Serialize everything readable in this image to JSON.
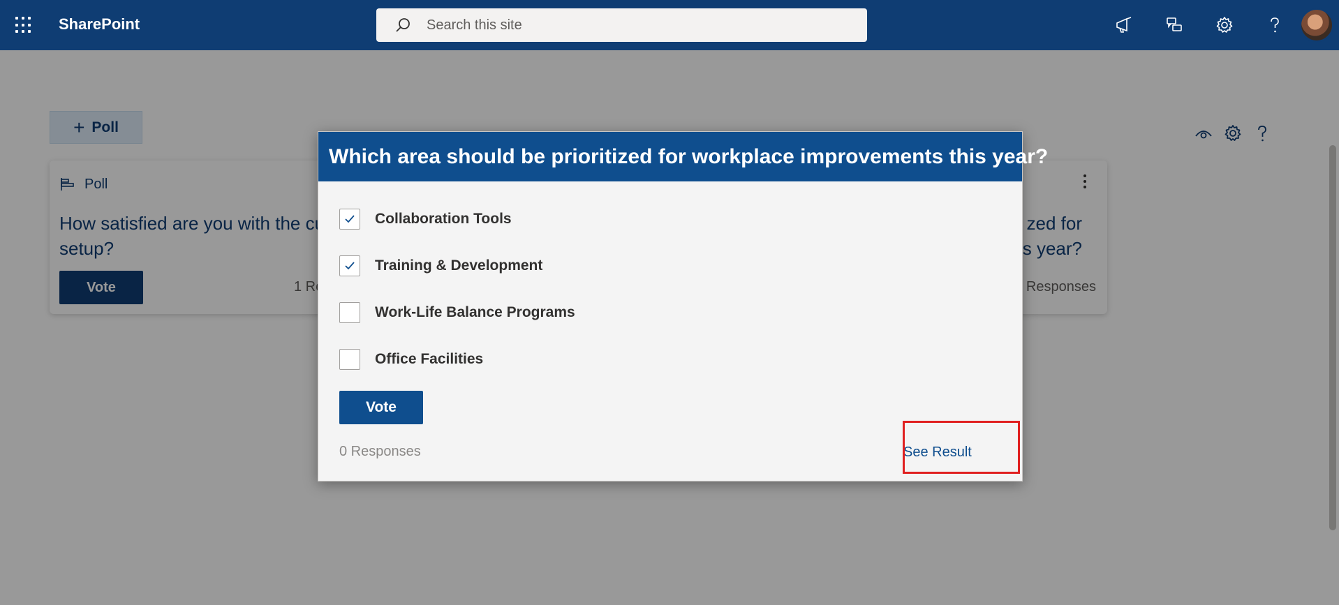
{
  "suitebar": {
    "app_name": "SharePoint",
    "search_placeholder": "Search this site",
    "icons": [
      "waffle-icon",
      "megaphone-icon",
      "feedback-icon",
      "gear-icon",
      "help-icon",
      "avatar"
    ]
  },
  "page": {
    "add_poll_label": "Poll",
    "add_poll_icon": "plus-icon",
    "tools": [
      "eye-icon",
      "gear-icon",
      "help-icon"
    ]
  },
  "cards": [
    {
      "tag": "Poll",
      "question": "How satisfied are you with the current remote work setup?",
      "vote_label": "Vote",
      "responses": "1 Re"
    },
    {
      "question_fragment_1": "zed for",
      "question_fragment_2": "s year?",
      "responses": ") Responses"
    }
  ],
  "dialog": {
    "title": "Which area should be prioritized for workplace improvements this year?",
    "options": [
      {
        "label": "Collaboration Tools",
        "checked": true
      },
      {
        "label": "Training & Development",
        "checked": true
      },
      {
        "label": "Work-Life Balance Programs",
        "checked": false
      },
      {
        "label": "Office Facilities",
        "checked": false
      }
    ],
    "vote_label": "Vote",
    "responses": "0 Responses",
    "see_result": "See Result"
  },
  "colors": {
    "suitebar": "#0f3d73",
    "dialog_header": "#0f4e8e",
    "highlight": "#e02020"
  }
}
